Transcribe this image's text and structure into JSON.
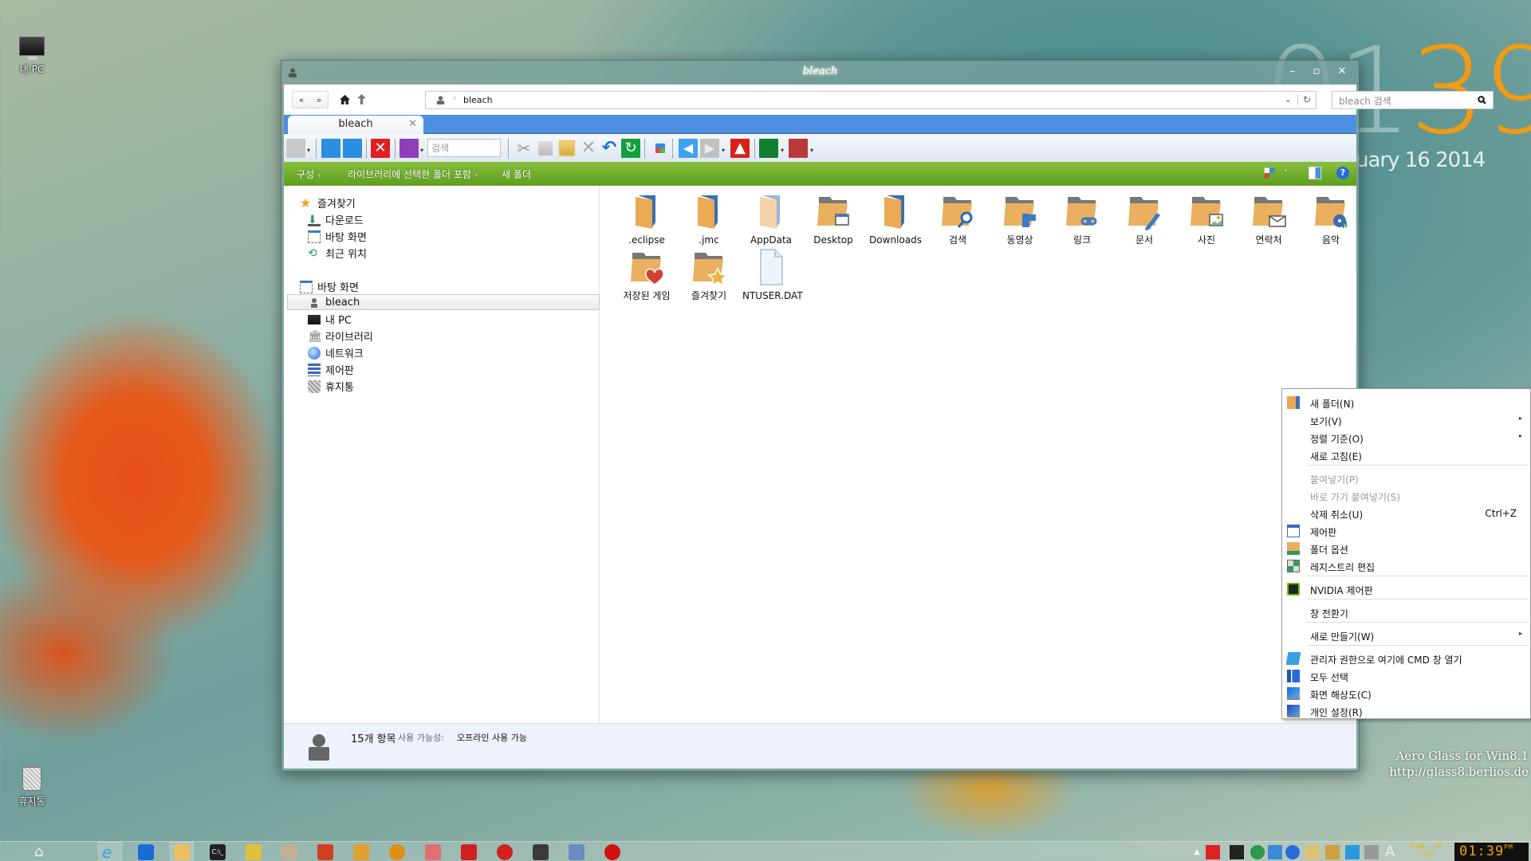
{
  "desktop": {
    "icons": [
      {
        "label": "내 PC",
        "icon": "monitor-icon"
      },
      {
        "label": "휴지통",
        "icon": "recycle-bin-icon"
      }
    ],
    "clock_widget": {
      "time_ghost": "01",
      "time_main": "39",
      "date": "uary 16 2014"
    },
    "watermark": {
      "line1": "Aero Glass for Win8.1",
      "line2": "http://glass8.berlios.de"
    }
  },
  "window": {
    "title": "bleach",
    "controls": {
      "minimize": "–",
      "maximize": "▫",
      "close": "✕"
    },
    "nav": {
      "back": "«",
      "forward": "»",
      "home_icon": "home-icon",
      "up_icon": "up-arrow-icon"
    },
    "address": {
      "crumb_sep": "›",
      "path": "bleach"
    },
    "search": {
      "placeholder": "bleach 검색"
    },
    "tabs": [
      {
        "label": "bleach",
        "close": "✕"
      }
    ],
    "toolbar": {
      "search_placeholder": "검색",
      "buttons": [
        "view-grid",
        "copy-to",
        "move-to",
        "delete-red",
        "details-view",
        "cut",
        "copy",
        "paste",
        "delete",
        "undo",
        "refresh",
        "thumbnails",
        "back-blue",
        "forward-gray",
        "up-red",
        "new-window",
        "bookmark"
      ]
    },
    "commandbar": {
      "items": [
        {
          "label": "구성",
          "dropdown": true
        },
        {
          "label": "라이브러리에 선택한 폴더 포함",
          "dropdown": true
        },
        {
          "label": "새 폴더",
          "dropdown": false
        }
      ],
      "right_icons": [
        "change-view-icon",
        "preview-pane-icon",
        "help-icon"
      ]
    },
    "navpane": {
      "favorites": {
        "label": "즐겨찾기",
        "items": [
          "다운로드",
          "바탕 화면",
          "최근 위치"
        ]
      },
      "desktop": {
        "label": "바탕 화면",
        "items": [
          "bleach",
          "내 PC",
          "라이브러리",
          "네트워크",
          "제어판",
          "휴지통"
        ],
        "selected": "bleach"
      }
    },
    "files": [
      {
        "name": ".eclipse",
        "type": "folder"
      },
      {
        "name": ".jmc",
        "type": "folder"
      },
      {
        "name": "AppData",
        "type": "folder-hidden"
      },
      {
        "name": "Desktop",
        "type": "folder-desktop"
      },
      {
        "name": "Downloads",
        "type": "folder"
      },
      {
        "name": "검색",
        "type": "folder-search"
      },
      {
        "name": "동영상",
        "type": "folder-videos"
      },
      {
        "name": "링크",
        "type": "folder-links"
      },
      {
        "name": "문서",
        "type": "folder-documents"
      },
      {
        "name": "사진",
        "type": "folder-pictures"
      },
      {
        "name": "연락처",
        "type": "folder-contacts"
      },
      {
        "name": "음악",
        "type": "folder-music"
      },
      {
        "name": "저장된 게임",
        "type": "folder-saved-games"
      },
      {
        "name": "즐겨찾기",
        "type": "folder-favorites"
      },
      {
        "name": "NTUSER.DAT",
        "type": "file"
      }
    ],
    "status": {
      "count": "15개 항목",
      "availability_label": "사용 가능성:",
      "availability_value": "오프라인 사용 가능"
    }
  },
  "context_menu": {
    "items": [
      {
        "label": "새 폴더(N)",
        "icon": "folder-icon"
      },
      {
        "label": "보기(V)",
        "submenu": true
      },
      {
        "label": "정렬 기준(O)",
        "submenu": true
      },
      {
        "label": "새로 고침(E)"
      },
      {
        "sep": true
      },
      {
        "label": "붙여넣기(P)",
        "disabled": true
      },
      {
        "label": "바로 가기 붙여넣기(S)",
        "disabled": true
      },
      {
        "label": "삭제 취소(U)",
        "shortcut": "Ctrl+Z"
      },
      {
        "label": "제어판",
        "icon": "control-panel-icon"
      },
      {
        "label": "폴더 옵션",
        "icon": "folder-options-icon"
      },
      {
        "label": "레지스트리 편집",
        "icon": "registry-icon"
      },
      {
        "sep": true
      },
      {
        "label": "NVIDIA 제어판",
        "icon": "nvidia-icon"
      },
      {
        "sep": true
      },
      {
        "label": "창 전환기"
      },
      {
        "sep": true
      },
      {
        "label": "새로 만들기(W)",
        "submenu": true
      },
      {
        "sep": true
      },
      {
        "label": "관리자 권한으로 여기에 CMD 창 열기",
        "icon": "cmd-icon"
      },
      {
        "label": "모두 선택",
        "icon": "select-all-icon"
      },
      {
        "label": "화면 해상도(C)",
        "icon": "display-resolution-icon"
      },
      {
        "label": "개인 설정(R)",
        "icon": "personalize-icon"
      }
    ],
    "submenu_arrow": "▸"
  },
  "taskbar": {
    "apps": [
      "start-home",
      "internet-explorer",
      "app-blue",
      "file-explorer",
      "cmd",
      "search-tool",
      "app-letter",
      "ccleaner",
      "app-puzzle",
      "aimp",
      "app-eraser",
      "app-installer",
      "app-red-circle",
      "app-winrar",
      "virtualbox",
      "power-app"
    ],
    "tray_icons": [
      "show-hidden",
      "network-app",
      "monitor-99",
      "utorrent",
      "globe-download",
      "malwarebytes",
      "clipboard",
      "folder-keyboard",
      "display",
      "audio-meter",
      "font-a"
    ],
    "date_line1": "SUN, 16",
    "date_line2": "FEB",
    "clock": "01:39",
    "ampm": "PM"
  },
  "colors": {
    "accent_tab": "#4d8fe0",
    "commandbar": "#6fae2c",
    "clock_orange": "#f29b12"
  }
}
